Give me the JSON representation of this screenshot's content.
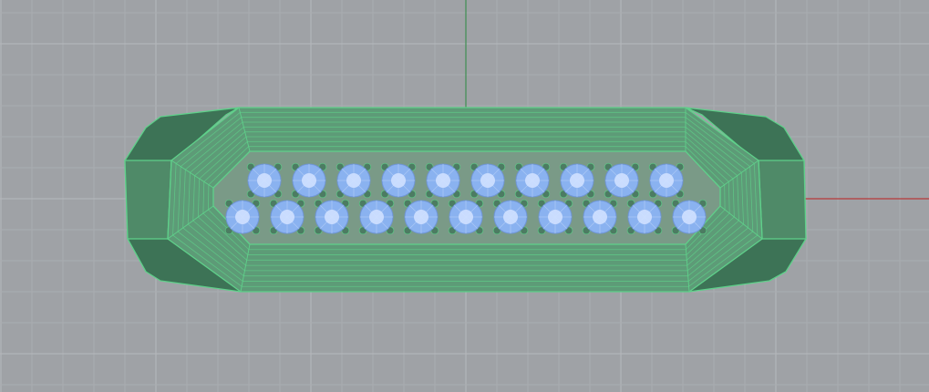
{
  "viewport": {
    "view": "Top",
    "background_color": "#9fa2a6",
    "grid_minor_color": "#aaadb1",
    "grid_major_color": "#b6b9bd"
  },
  "axes": {
    "x_axis_color": "#b83a3a",
    "y_axis_color": "#3f8f52"
  },
  "model": {
    "type": "ring",
    "view_icon": "gem-ring-top-view",
    "edge_color": "#5fd08a",
    "body_color": "#4f8a68",
    "body_light_color": "#5d9b77",
    "body_dark_color": "#3d7356",
    "channel_color": "#7a9a87",
    "gem_color": "#8ab2f0",
    "gem_highlight_color": "#cfe0ff",
    "prong_color": "#4c7c62",
    "stone_rows": 2,
    "stones_per_row": 10
  }
}
